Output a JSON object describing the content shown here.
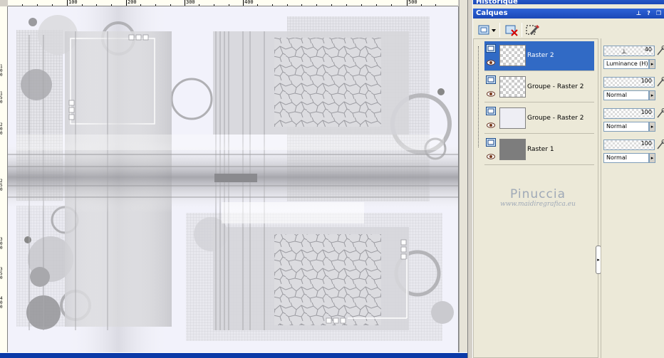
{
  "rulers": {
    "top_labels": [
      "100",
      "200",
      "300",
      "400",
      "500"
    ],
    "left_labels": [
      "1",
      "0",
      "0",
      "1",
      "5",
      "0",
      "2",
      "0",
      "0",
      "2",
      "5",
      "0",
      "3",
      "0",
      "0",
      "3",
      "5",
      "0",
      "4",
      "0",
      "0"
    ]
  },
  "panels": {
    "history_title": "Historique",
    "layers_title": "Calques"
  },
  "layers": [
    {
      "name": "Raster 2",
      "opacity": "40",
      "blend": "Luminance (H)",
      "selected": true
    },
    {
      "name": "Groupe - Raster 2",
      "opacity": "100",
      "blend": "Normal",
      "selected": false
    },
    {
      "name": "Groupe - Raster 2",
      "opacity": "100",
      "blend": "Normal",
      "selected": false
    },
    {
      "name": "Raster 1",
      "opacity": "100",
      "blend": "Normal",
      "selected": false
    }
  ],
  "watermark": {
    "name": "Pinuccia",
    "url": "www.maidiregrafica.eu"
  },
  "colors": {
    "selection": "#316ac5",
    "titlebar": "#2d63d8",
    "panel_bg": "#ece9d8"
  }
}
